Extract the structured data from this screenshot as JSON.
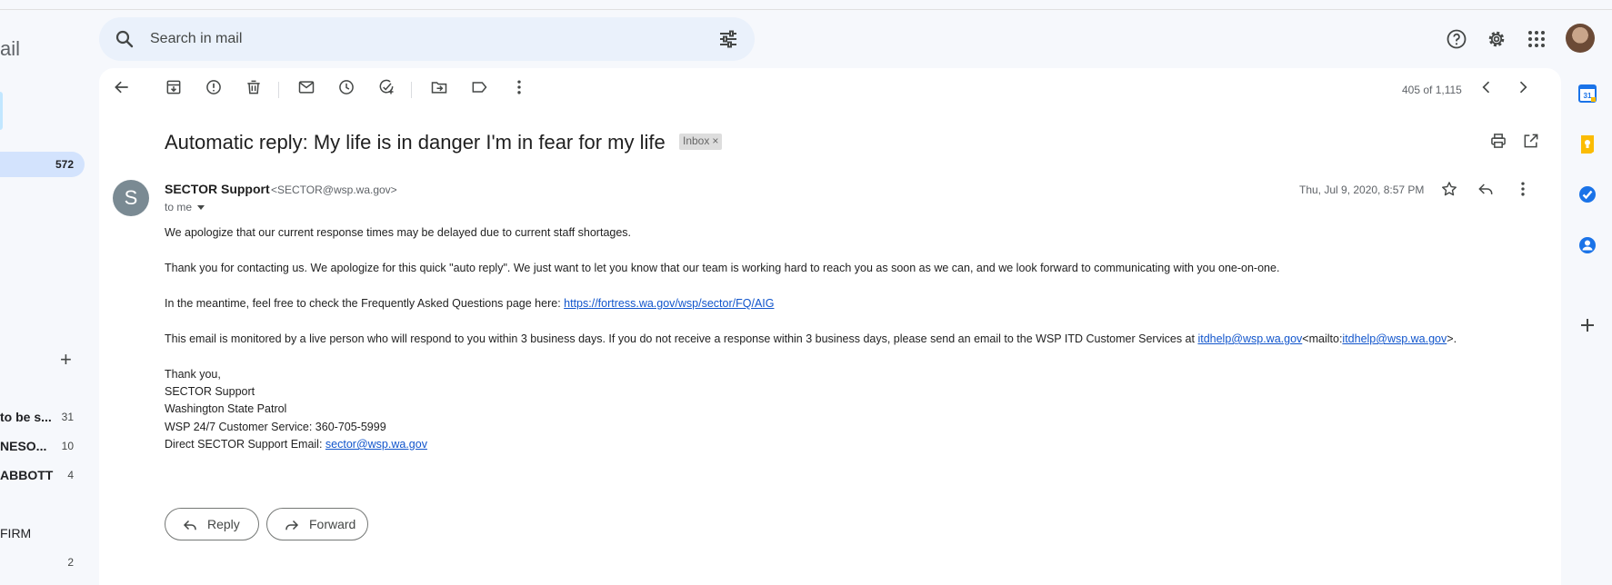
{
  "nav": {
    "logo_fragment": "ail",
    "inbox_count": "572",
    "labels": [
      {
        "name": "to be s...",
        "count": "31",
        "bold": true
      },
      {
        "name": "NESO...",
        "count": "10",
        "bold": true
      },
      {
        "name": "ABBOTT",
        "count": "4",
        "bold": true
      },
      {
        "name": "FIRM",
        "count": "",
        "bold": false
      },
      {
        "name": "",
        "count": "2",
        "bold": false
      }
    ]
  },
  "search": {
    "placeholder": "Search in mail"
  },
  "toolbar": {
    "pager": "405 of 1,115"
  },
  "email": {
    "subject": "Automatic reply: My life is in danger I'm in fear for my life",
    "label_badge": "Inbox",
    "badge_close": "×",
    "sender_initial": "S",
    "sender_name": "SECTOR Support",
    "sender_email": "<SECTOR@wsp.wa.gov>",
    "recipient": "to me",
    "date": "Thu, Jul 9, 2020, 8:57 PM",
    "body": {
      "p1": "We apologize that our current response times may be delayed due to current staff shortages.",
      "p2": "Thank you for contacting us. We apologize for this quick \"auto reply\". We just want to let you know that our team is working hard to reach you as soon as we can, and we look forward to communicating with you one-on-one.",
      "p3_text": "In the meantime, feel free to check the Frequently Asked Questions page here: ",
      "p3_link": "https://fortress.wa.gov/wsp/sector/FQ/AIG",
      "p4_text": "This email is monitored by a live person who will respond to you within 3 business days. If you do not receive a response within 3 business days, please send an email to the WSP ITD Customer Services at ",
      "p4_link1": "itdhelp@wsp.wa.gov",
      "p4_mid": "<mailto:",
      "p4_link2": "itdhelp@wsp.wa.gov",
      "p4_end": ">.",
      "sig1": "Thank you,",
      "sig2": "SECTOR Support",
      "sig3": "Washington State Patrol",
      "sig4": "WSP 24/7 Customer Service: 360-705-5999",
      "sig5_text": "Direct SECTOR Support Email: ",
      "sig5_link": "sector@wsp.wa.gov"
    }
  },
  "actions": {
    "reply": "Reply",
    "forward": "Forward"
  },
  "side_apps": {
    "calendar_day": "31"
  },
  "colors": {
    "accent": "#0b57d0",
    "link": "#1155cc",
    "nav_selected": "#d3e3fd",
    "background": "#f6f8fc"
  }
}
